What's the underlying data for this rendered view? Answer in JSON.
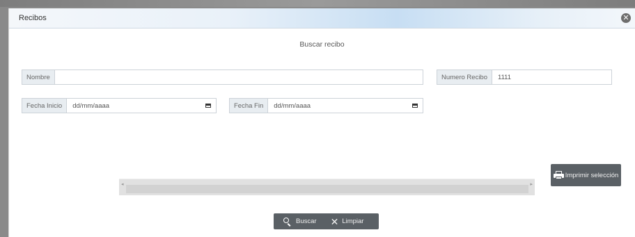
{
  "dialog": {
    "title": "Recibos",
    "close_glyph": "✕",
    "heading": "Buscar recibo"
  },
  "filters": {
    "nombre": {
      "label": "Nombre",
      "value": ""
    },
    "numero_recibo": {
      "label": "Numero Recibo",
      "value": "1111"
    },
    "fecha_inicio": {
      "label": "Fecha Inicio",
      "placeholder": "dd/mm/aaaa"
    },
    "fecha_fin": {
      "label": "Fecha Fin",
      "placeholder": "dd/mm/aaaa"
    }
  },
  "scroll": {
    "left_arrow": "◂",
    "right_arrow": "▸"
  },
  "actions": {
    "print_label": "Imprimir selección",
    "search_label": "Buscar",
    "clear_label": "Limpiar",
    "clear_glyph": "✕"
  },
  "icons": {
    "close": "close-icon",
    "calendar": "calendar-icon",
    "printer": "printer-icon",
    "search": "search-icon",
    "clear": "x-icon"
  },
  "colors": {
    "button_bg": "#5a6065",
    "titlebar_accent": "#c7def3",
    "label_bg": "#e8edf1"
  }
}
